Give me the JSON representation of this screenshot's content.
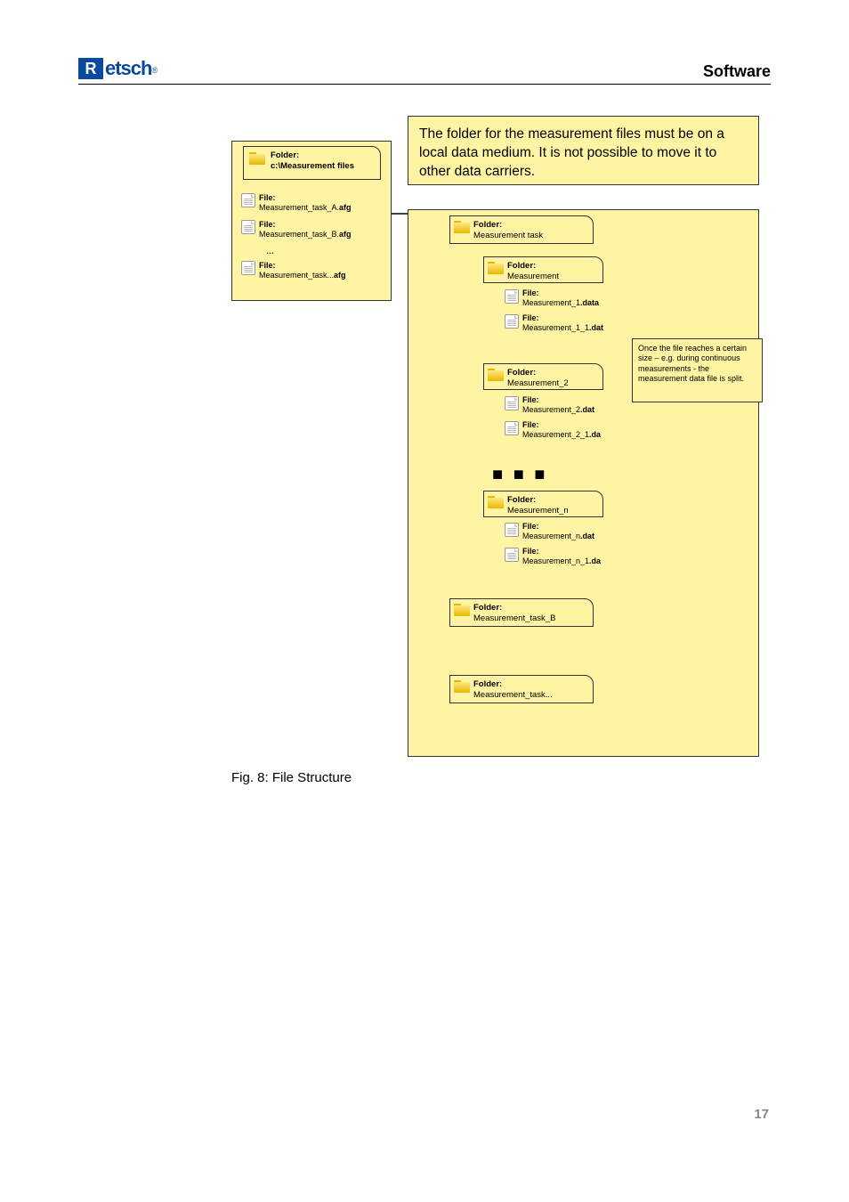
{
  "header": {
    "logo_text": "etsch",
    "section_title": "Software"
  },
  "diagram": {
    "top_note": "The folder for the measurement files must be on a local data medium. It is not possible to move it to other data carriers.",
    "side_note": "Once the file reaches a certain size – e.g. during continuous measurements - the measurement data file is split.",
    "root_folder": {
      "label": "Folder:",
      "name": "c:\\Measurement files"
    },
    "left_files": [
      {
        "label": "File:",
        "name": "Measurement_task_A.",
        "ext": "afg"
      },
      {
        "label": "File:",
        "name": "Measurement_task_B.",
        "ext": "afg"
      },
      {
        "label": "File:",
        "name": "Measurement_task...",
        "ext": "afg"
      }
    ],
    "ellipsis": "…",
    "task_folder": {
      "label": "Folder:",
      "name": "Measurement task"
    },
    "measurements": [
      {
        "folder": {
          "label": "Folder:",
          "name": "Measurement"
        },
        "files": [
          {
            "label": "File:",
            "name": "Measurement_1",
            "ext": ".data"
          },
          {
            "label": "File:",
            "name": "Measurement_1_1",
            "ext": ".dat"
          }
        ]
      },
      {
        "folder": {
          "label": "Folder:",
          "name": "Measurement_2"
        },
        "files": [
          {
            "label": "File:",
            "name": "Measurement_2",
            "ext": ".dat"
          },
          {
            "label": "File:",
            "name": "Measurement_2_1",
            "ext": ".da"
          }
        ]
      },
      {
        "folder": {
          "label": "Folder:",
          "name": "Measurement_n"
        },
        "files": [
          {
            "label": "File:",
            "name": "Measurement_n",
            "ext": ".dat"
          },
          {
            "label": "File:",
            "name": "Measurement_n_1",
            "ext": ".da"
          }
        ]
      }
    ],
    "dots": "■ ■ ■",
    "task_b": {
      "label": "Folder:",
      "name": "Measurement_task_B"
    },
    "task_dots": {
      "label": "Folder:",
      "name": "Measurement_task..."
    }
  },
  "caption": "Fig. 8: File Structure",
  "page_number": "17"
}
